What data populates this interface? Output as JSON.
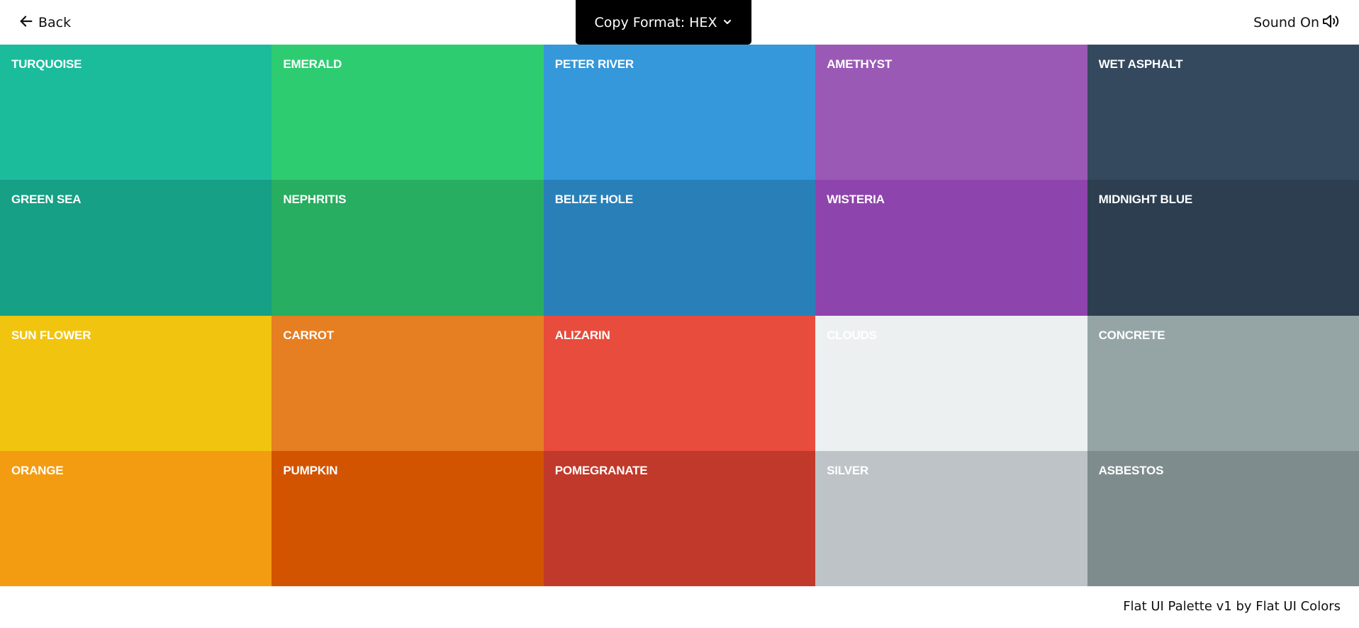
{
  "header": {
    "back_label": "Back",
    "format_label": "Copy Format: HEX",
    "sound_label": "Sound On"
  },
  "palette": [
    {
      "name": "TURQUOISE",
      "color": "#1abc9c"
    },
    {
      "name": "EMERALD",
      "color": "#2ecc71"
    },
    {
      "name": "PETER RIVER",
      "color": "#3498db"
    },
    {
      "name": "AMETHYST",
      "color": "#9b59b6"
    },
    {
      "name": "WET ASPHALT",
      "color": "#34495e"
    },
    {
      "name": "GREEN SEA",
      "color": "#16a085"
    },
    {
      "name": "NEPHRITIS",
      "color": "#27ae60"
    },
    {
      "name": "BELIZE HOLE",
      "color": "#2980b9"
    },
    {
      "name": "WISTERIA",
      "color": "#8e44ad"
    },
    {
      "name": "MIDNIGHT BLUE",
      "color": "#2c3e50"
    },
    {
      "name": "SUN FLOWER",
      "color": "#f1c40f"
    },
    {
      "name": "CARROT",
      "color": "#e67e22"
    },
    {
      "name": "ALIZARIN",
      "color": "#e74c3c"
    },
    {
      "name": "CLOUDS",
      "color": "#ecf0f1"
    },
    {
      "name": "CONCRETE",
      "color": "#95a5a6"
    },
    {
      "name": "ORANGE",
      "color": "#f39c12"
    },
    {
      "name": "PUMPKIN",
      "color": "#d35400"
    },
    {
      "name": "POMEGRANATE",
      "color": "#c0392b"
    },
    {
      "name": "SILVER",
      "color": "#bdc3c7"
    },
    {
      "name": "ASBESTOS",
      "color": "#7f8c8d"
    }
  ],
  "footer": {
    "credit": "Flat UI Palette v1 by Flat UI Colors"
  }
}
